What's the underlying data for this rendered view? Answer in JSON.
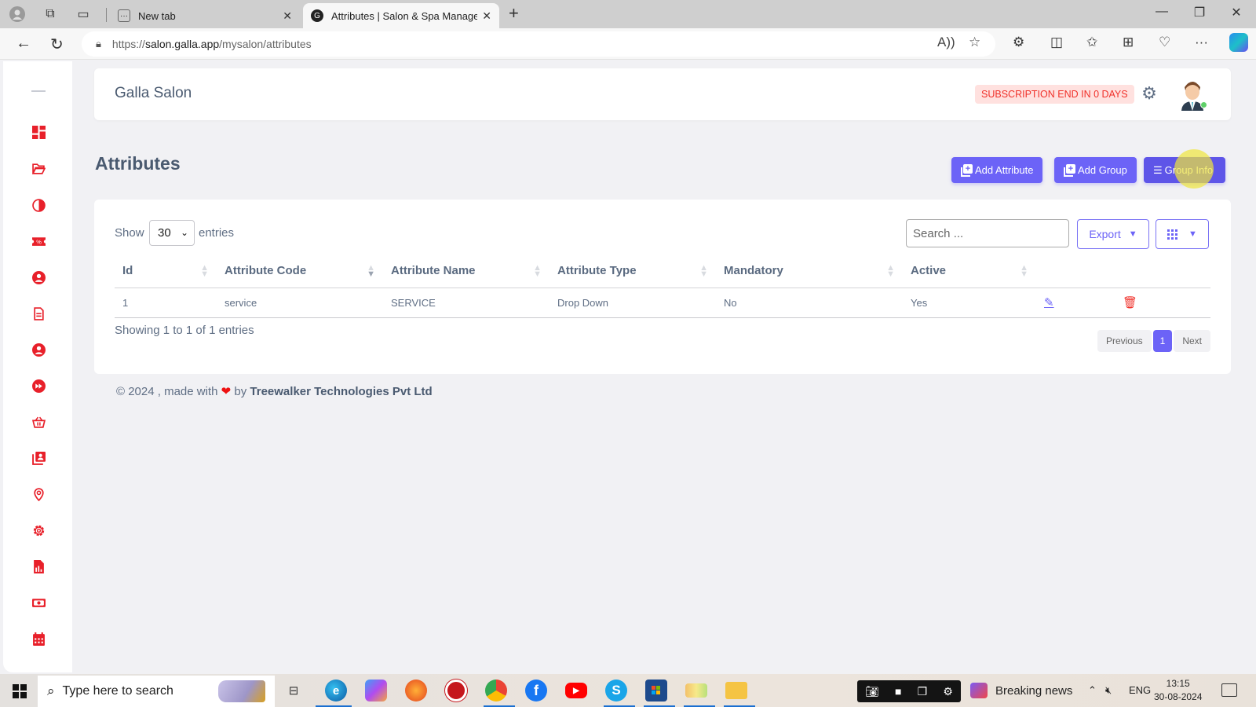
{
  "browser": {
    "tabs": [
      {
        "title": "New tab",
        "active": false
      },
      {
        "title": "Attributes | Salon & Spa Managem",
        "active": true
      }
    ],
    "url_prefix": "https://",
    "url_host": "salon.galla.app",
    "url_path": "/mysalon/attributes"
  },
  "sidebar": {
    "icons": [
      "dashboard-icon",
      "folder-icon",
      "contrast-icon",
      "coupon-icon",
      "user-circle-icon",
      "document-icon",
      "user-circle-icon",
      "fast-forward-icon",
      "basket-icon",
      "contacts-icon",
      "location-pin-icon",
      "settings-icon",
      "report-icon",
      "money-icon",
      "calendar-icon"
    ]
  },
  "header": {
    "brand": "Galla Salon",
    "subscription_badge": "SUBSCRIPTION END IN 0 DAYS",
    "status_color": "#5fd068"
  },
  "page": {
    "title": "Attributes",
    "buttons": {
      "add_attribute": "Add Attribute",
      "add_group": "Add Group",
      "group_info": "Group Info"
    }
  },
  "table_controls": {
    "show_label": "Show",
    "page_size": "30",
    "entries_label": "entries",
    "search_placeholder": "Search ...",
    "export_label": "Export"
  },
  "table": {
    "columns": [
      "Id",
      "Attribute Code",
      "Attribute Name",
      "Attribute Type",
      "Mandatory",
      "Active",
      ""
    ],
    "rows": [
      {
        "id": "1",
        "code": "service",
        "name": "SERVICE",
        "type": "Drop Down",
        "mandatory": "No",
        "active": "Yes"
      }
    ],
    "info": "Showing 1 to 1 of 1 entries",
    "pagination": {
      "previous": "Previous",
      "current": "1",
      "next": "Next"
    }
  },
  "footer": {
    "prefix": "© 2024 , made with",
    "by": "by",
    "company": "Treewalker Technologies Pvt Ltd"
  },
  "taskbar": {
    "search_placeholder": "Type here to search",
    "news": "Breaking news",
    "language": "ENG",
    "time": "13:15",
    "date": "30-08-2024"
  },
  "colors": {
    "accent": "#6c63f7",
    "sidebar_icon": "#e8202a",
    "danger": "#f0312a"
  }
}
